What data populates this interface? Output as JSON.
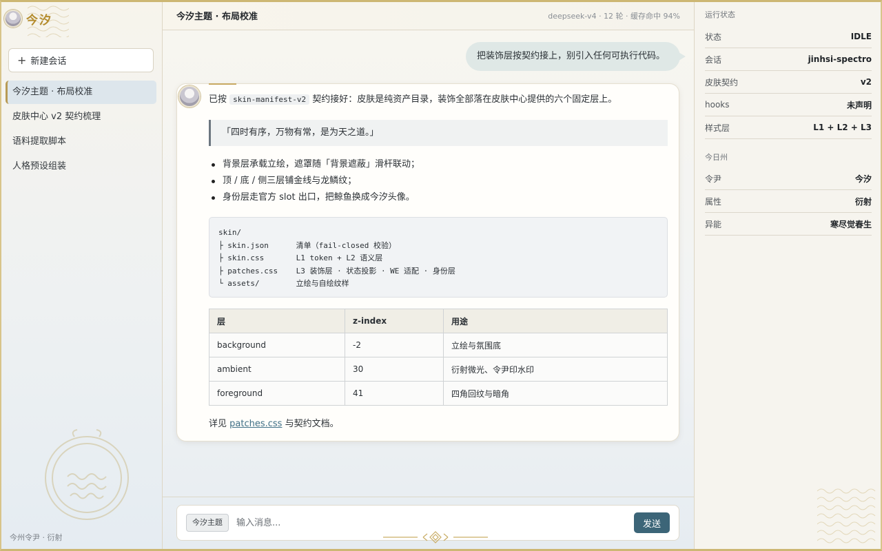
{
  "sidebar": {
    "brand": "今汐",
    "new_chat": "新建会话",
    "conversations": [
      {
        "label": "今汐主题 · 布局校准"
      },
      {
        "label": "皮肤中心 v2 契约梳理"
      },
      {
        "label": "语料提取脚本"
      },
      {
        "label": "人格预设组装"
      }
    ],
    "footer": "今州令尹 · 衍射"
  },
  "header": {
    "title": "今汐主题 · 布局校准",
    "meta": "deepseek-v4 · 12 轮 · 缓存命中 94%"
  },
  "chat": {
    "user_message": "把装饰层按契约接上，别引入任何可执行代码。",
    "bot": {
      "intro_before": "已按",
      "intro_code": "skin-manifest-v2",
      "intro_after": "契约接好：皮肤是纯资产目录，装饰全部落在皮肤中心提供的六个固定层上。",
      "quote": "「四时有序，万物有常，是为天之道。」",
      "bullets": [
        "背景层承载立绘，遮罩随「背景遮蔽」滑杆联动；",
        "顶 / 底 / 侧三层铺金线与龙鳞纹；",
        "身份层走官方 slot 出口，把鲸鱼换成今汐头像。"
      ],
      "code": "skin/\n├ skin.json      清单（fail-closed 校验）\n├ skin.css       L1 token + L2 语义层\n├ patches.css    L3 装饰层 · 状态投影 · WE 适配 · 身份层\n└ assets/        立绘与自绘纹样",
      "table": {
        "headers": [
          "层",
          "z-index",
          "用途"
        ],
        "rows": [
          [
            "background",
            "-2",
            "立绘与氛围底"
          ],
          [
            "ambient",
            "30",
            "衍射微光、令尹印水印"
          ],
          [
            "foreground",
            "41",
            "四角回纹与暗角"
          ]
        ]
      },
      "see_more_before": "详见",
      "see_more_link": "patches.css",
      "see_more_after": "与契约文档。"
    }
  },
  "composer": {
    "chip": "今汐主题",
    "placeholder": "输入消息...",
    "send": "发送"
  },
  "right_panel": {
    "status_title": "运行状态",
    "status_rows": [
      {
        "k": "状态",
        "v": "IDLE"
      },
      {
        "k": "会话",
        "v": "jinhsi-spectro"
      },
      {
        "k": "皮肤契约",
        "v": "v2"
      },
      {
        "k": "hooks",
        "v": "未声明"
      },
      {
        "k": "样式层",
        "v": "L1 + L2 + L3"
      }
    ],
    "region_title": "今日州",
    "region_rows": [
      {
        "k": "令尹",
        "v": "今汐"
      },
      {
        "k": "属性",
        "v": "衍射"
      },
      {
        "k": "异能",
        "v": "寒尽觉春生"
      }
    ]
  },
  "colors": {
    "gold": "#b48c2d",
    "send_button": "#3c6578",
    "user_bubble": "#dfe8e6",
    "active_item": "#dde6ec"
  }
}
